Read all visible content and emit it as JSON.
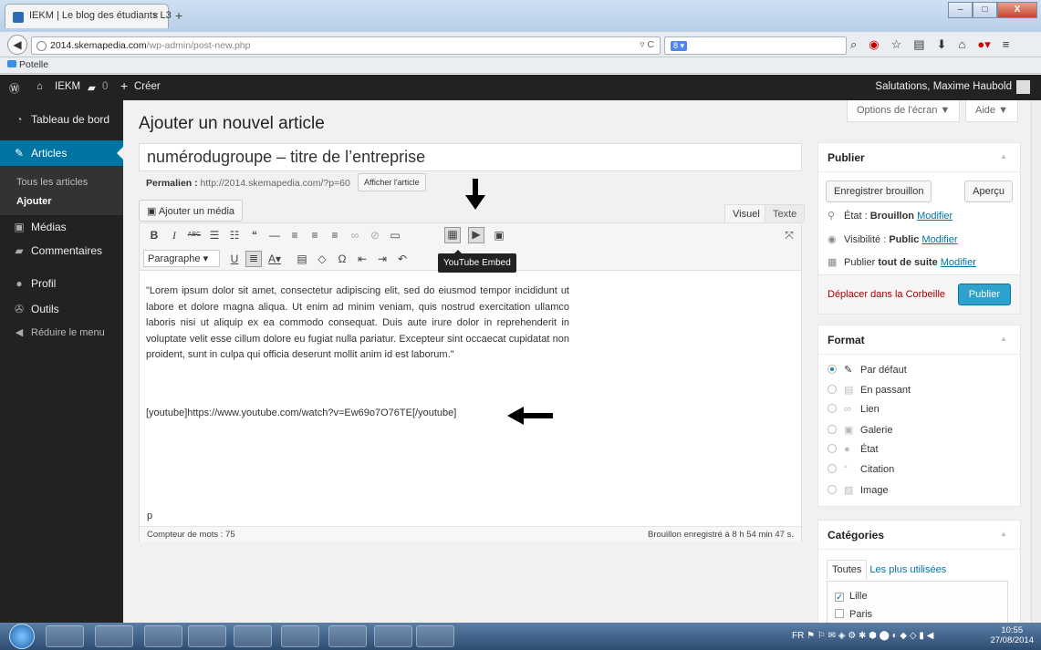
{
  "browser": {
    "tab_title": "IEKM | Le blog des étudiants L3",
    "tab_close": "×",
    "new_tab": "+",
    "url_domain": "2014.skemapedia.com",
    "url_path": "/wp-admin/post-new.php",
    "bookmark": "Potelle",
    "search_engine": "8 ▾",
    "win_min": "–",
    "win_max": "□",
    "win_close": "X"
  },
  "adminbar": {
    "site": "IEKM",
    "comments_count": "0",
    "create": "Créer",
    "greeting": "Salutations, Maxime Haubold"
  },
  "sidebar": {
    "dashboard": "Tableau de bord",
    "articles": "Articles",
    "all_articles": "Tous les articles",
    "add": "Ajouter",
    "media": "Médias",
    "comments": "Commentaires",
    "profile": "Profil",
    "tools": "Outils",
    "collapse": "Réduire le menu"
  },
  "page": {
    "title": "Ajouter un nouvel article",
    "screen_options": "Options de l'écran ▼",
    "help": "Aide ▼"
  },
  "editor": {
    "post_title": "numérodugroupe – titre de l’entreprise",
    "permalink_label": "Permalien :",
    "permalink_url": "http://2014.skemapedia.com/?p=60",
    "show_article": "Afficher l'article",
    "add_media": "Ajouter un média",
    "tab_visual": "Visuel",
    "tab_text": "Texte",
    "format_select": "Paragraphe",
    "tooltip": "YouTube Embed",
    "body": "\"Lorem ipsum dolor sit amet, consectetur adipiscing elit, sed do eiusmod tempor incididunt ut labore et dolore magna aliqua. Ut enim ad minim veniam, quis nostrud exercitation ullamco laboris nisi ut aliquip ex ea commodo consequat. Duis aute irure dolor in reprehenderit in voluptate velit esse cillum dolore eu fugiat nulla pariatur. Excepteur sint occaecat cupidatat non proident, sunt in culpa qui officia deserunt mollit anim id est laborum.\"",
    "shortcode": "[youtube]https://www.youtube.com/watch?v=Ew69o7O76TE[/youtube]",
    "path": "p",
    "word_count": "Compteur de mots : 75",
    "saved_status": "Brouillon enregistré à 8 h 54 min 47 s."
  },
  "publish": {
    "heading": "Publier",
    "save_draft": "Enregistrer brouillon",
    "preview": "Aperçu",
    "status_label": "État :",
    "status_value": "Brouillon",
    "visibility_label": "Visibilité :",
    "visibility_value": "Public",
    "publish_label": "Publier",
    "publish_value": "tout de suite",
    "modify": "Modifier",
    "trash": "Déplacer dans la Corbeille",
    "publish_button": "Publier"
  },
  "format": {
    "heading": "Format",
    "options": [
      "Par défaut",
      "En passant",
      "Lien",
      "Galerie",
      "État",
      "Citation",
      "Image"
    ]
  },
  "categories": {
    "heading": "Catégories",
    "tab_all": "Toutes",
    "tab_popular": "Les plus utilisées",
    "items": [
      "Lille",
      "Paris"
    ]
  },
  "taskbar": {
    "lang": "FR",
    "time": "10:55",
    "date": "27/08/2014"
  }
}
